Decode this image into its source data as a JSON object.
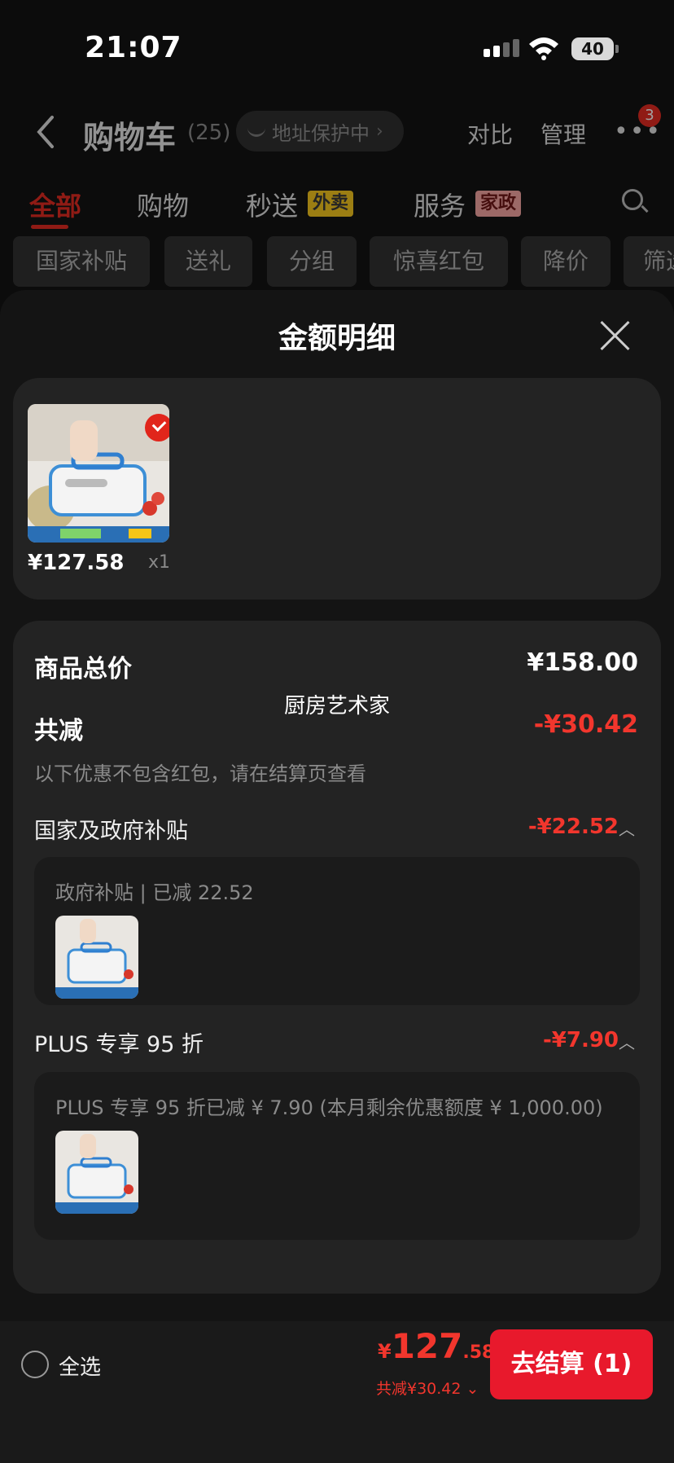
{
  "status_bar": {
    "time": "21:07",
    "battery": "40"
  },
  "header": {
    "title": "购物车",
    "count": "(25)",
    "address_pill": "地址保护中",
    "compare": "对比",
    "manage": "管理",
    "more_badge": "3"
  },
  "tabs": [
    {
      "label": "全部"
    },
    {
      "label": "购物"
    },
    {
      "label": "秒送",
      "badge": "外卖"
    },
    {
      "label": "服务",
      "badge": "家政"
    }
  ],
  "filters": [
    "国家补贴",
    "送礼",
    "分组",
    "惊喜红包",
    "降价",
    "筛选"
  ],
  "sheet": {
    "title": "金额明细",
    "product": {
      "price": "¥127.58",
      "qty": "x1"
    },
    "summary": {
      "total_label": "商品总价",
      "total_value": "¥158.00",
      "shop_name": "厨房艺术家",
      "discount_label": "共减",
      "discount_value": "-¥30.42",
      "note": "以下优惠不包含红包，请在结算页查看"
    },
    "sections": [
      {
        "label": "国家及政府补贴",
        "value": "-¥22.52",
        "detail": "政府补贴 | 已减 22.52"
      },
      {
        "label": "PLUS 专享 95 折",
        "value": "-¥7.90",
        "detail": "PLUS 专享 95 折已减 ¥ 7.90 (本月剩余优惠额度 ¥ 1,000.00)"
      }
    ]
  },
  "bottom_bar": {
    "select_all": "全选",
    "price_currency": "¥",
    "price_int": "127",
    "price_dec": ".58",
    "total_discount": "共减¥30.42",
    "checkout": "去结算 (1)"
  },
  "colors": {
    "accent": "#e1251b",
    "discount": "#f2362d",
    "sheet_bg": "#141414",
    "card_bg": "#232323"
  }
}
